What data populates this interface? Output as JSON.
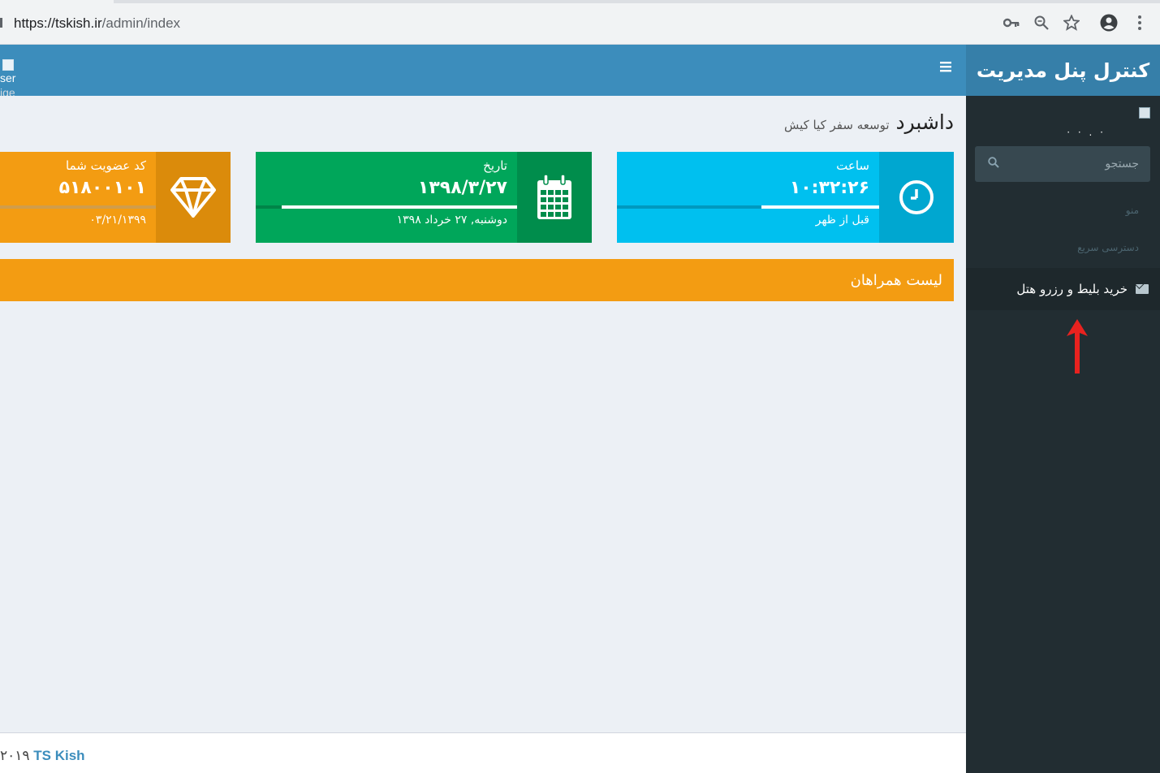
{
  "browser": {
    "url_host": "https://tskish.ir",
    "url_path": "/admin/index"
  },
  "header": {
    "user_image_alt_1": "ser",
    "user_image_alt_2": "ige",
    "brand": "کنترل پنل مدیریت"
  },
  "sidebar": {
    "user_name": "· . · ·",
    "search_placeholder": "جستجو",
    "header_menu": "منو",
    "header_quick": "دسترسی سریع",
    "item_label": "خرید بلیط و رزرو هتل"
  },
  "content": {
    "title": "داشبرد",
    "subtitle": "توسعه سفر کیا کیش"
  },
  "info_boxes": {
    "clock": {
      "title": "ساعت",
      "value": "۱۰:۳۲:۲۶",
      "desc": "قبل از ظهر",
      "progress": 0.45,
      "color": "#00c0ef"
    },
    "date": {
      "title": "تاریخ",
      "value": "۱۳۹۸/۳/۲۷",
      "desc": "دوشنبه, ۲۷ خرداد ۱۳۹۸",
      "progress": 0.9,
      "color": "#00a65a"
    },
    "member": {
      "title": "کد عضویت شما",
      "value": "۵۱۸۰۰۱۰۱",
      "desc": "۰۳/۲۱/۱۳۹۹",
      "progress": 1.0,
      "color": "#f39c12"
    }
  },
  "companions_box": {
    "title": "لیست همراهان"
  },
  "footer": {
    "year": "۲۰۱۹",
    "link": "TS Kish"
  }
}
